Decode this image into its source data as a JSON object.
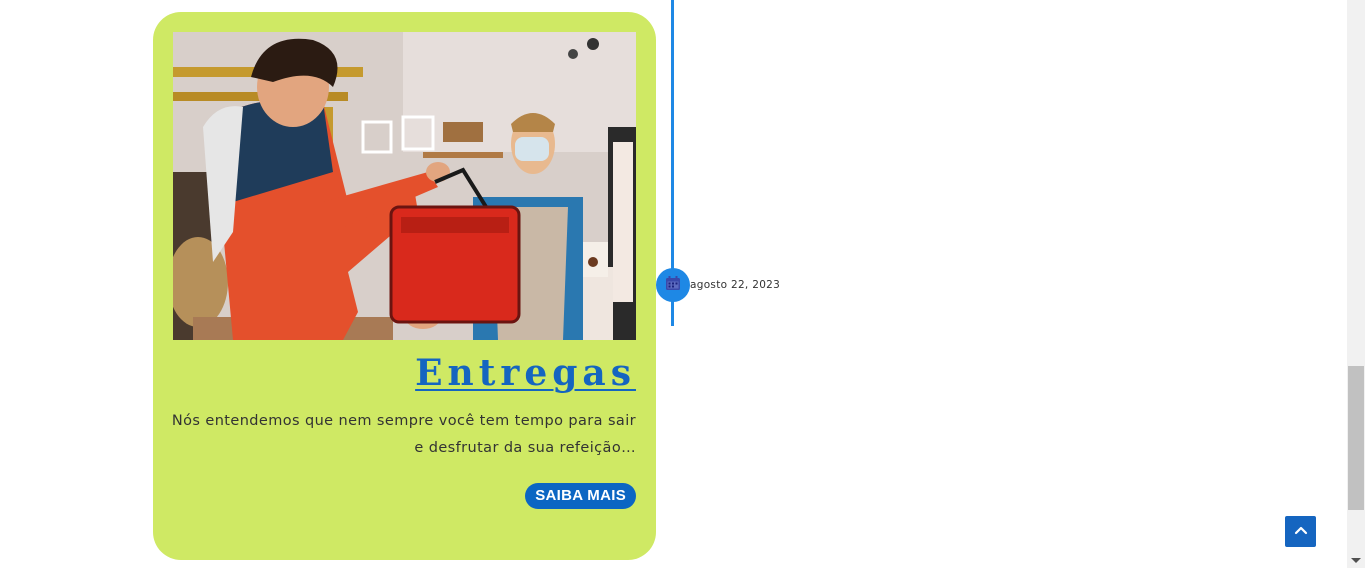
{
  "post": {
    "image_alt": "Entregador recebendo bolsa térmica vermelha em um café",
    "title": "Entregas",
    "excerpt": "Nós entendemos que nem sempre você tem tempo para sair e desfrutar da sua refeição…",
    "read_more_label": "SAIBA MAIS",
    "date": "agosto 22, 2023"
  },
  "colors": {
    "card_bg": "#cfe964",
    "accent": "#1565c0",
    "timeline": "#1e88e5"
  },
  "icons": {
    "date_icon": "calendar-icon",
    "back_to_top": "chevron-up-icon"
  }
}
